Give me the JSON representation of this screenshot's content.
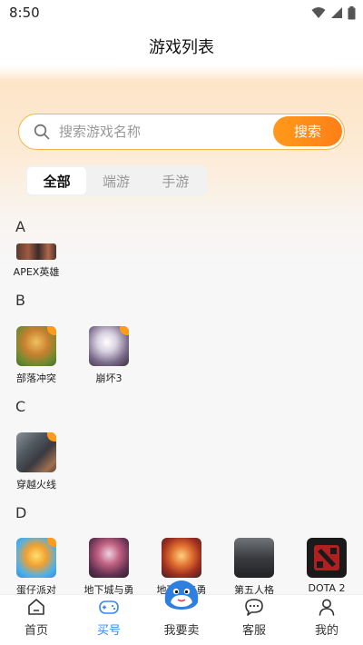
{
  "status_bar": {
    "time": "8:50"
  },
  "header": {
    "title": "游戏列表"
  },
  "search": {
    "placeholder": "搜索游戏名称",
    "value": "",
    "button_label": "搜索"
  },
  "filter_tabs": [
    {
      "label": "全部",
      "active": true
    },
    {
      "label": "端游",
      "active": false
    },
    {
      "label": "手游",
      "active": false
    }
  ],
  "sections": [
    {
      "letter": "A",
      "games": [
        {
          "name": "APEX英雄",
          "icon": "apex-icon"
        }
      ]
    },
    {
      "letter": "B",
      "games": [
        {
          "name": "部落冲突",
          "icon": "clash-of-clans-icon"
        },
        {
          "name": "崩坏3",
          "icon": "honkai-3-icon"
        }
      ]
    },
    {
      "letter": "C",
      "games": [
        {
          "name": "穿越火线",
          "icon": "crossfire-icon"
        }
      ]
    },
    {
      "letter": "D",
      "games": [
        {
          "name": "蛋仔派对",
          "icon": "eggy-party-icon"
        },
        {
          "name": "地下城与勇",
          "icon": "dnf-icon"
        },
        {
          "name": "地下城与勇",
          "icon": "dnf-mobile-icon"
        },
        {
          "name": "第五人格",
          "icon": "identity-v-icon"
        },
        {
          "name": "DOTA 2",
          "icon": "dota2-icon"
        }
      ]
    }
  ],
  "tabbar": [
    {
      "label": "首页",
      "icon": "home-icon",
      "active": false
    },
    {
      "label": "买号",
      "icon": "gamepad-icon",
      "active": true
    },
    {
      "label": "我要卖",
      "icon": "mascot-icon",
      "active": false
    },
    {
      "label": "客服",
      "icon": "chat-icon",
      "active": false
    },
    {
      "label": "我的",
      "icon": "user-icon",
      "active": false
    }
  ],
  "colors": {
    "accent": "#ff8a1a",
    "search_border": "#f2b64a",
    "tab_active": "#3a86f0"
  }
}
